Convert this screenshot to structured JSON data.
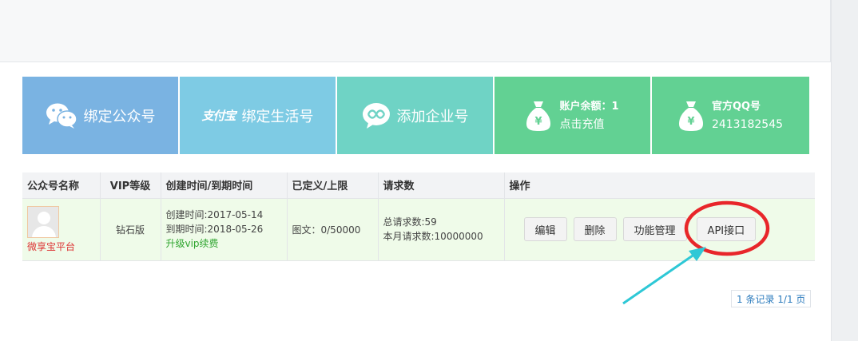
{
  "tiles": [
    {
      "label": "绑定公众号",
      "icon": "wechat-icon"
    },
    {
      "label": "绑定生活号",
      "icon": "alipay-icon",
      "icon_text": "支付宝"
    },
    {
      "label": "添加企业号",
      "icon": "enterprise-wechat-icon"
    },
    {
      "line1": "账户余额：1",
      "line2": "点击充值",
      "icon": "money-bag-icon"
    },
    {
      "line1": "官方QQ号",
      "line2": "2413182545",
      "icon": "money-bag-icon"
    }
  ],
  "table": {
    "headers": [
      "公众号名称",
      "VIP等级",
      "创建时间/到期时间",
      "已定义/上限",
      "请求数",
      "操作"
    ],
    "rows": [
      {
        "name": "微享宝平台",
        "vip": "钻石版",
        "created": "创建时间:2017-05-14",
        "expires": "到期时间:2018-05-26",
        "upgrade": "升级vip续费",
        "defined": "图文：0/50000",
        "total_requests": "总请求数:59",
        "month_requests": "本月请求数:10000000",
        "actions": [
          "编辑",
          "删除",
          "功能管理",
          "API接口"
        ]
      }
    ]
  },
  "pager": "1 条记录 1/1 页",
  "colors": {
    "tile1": "#7ab3e2",
    "tile2": "#7ecbe4",
    "tile3": "#6fd3c5",
    "tile4": "#62d193",
    "row_bg": "#effbe9",
    "annotation_red": "#e8262a",
    "annotation_arrow": "#2ec8d6"
  }
}
